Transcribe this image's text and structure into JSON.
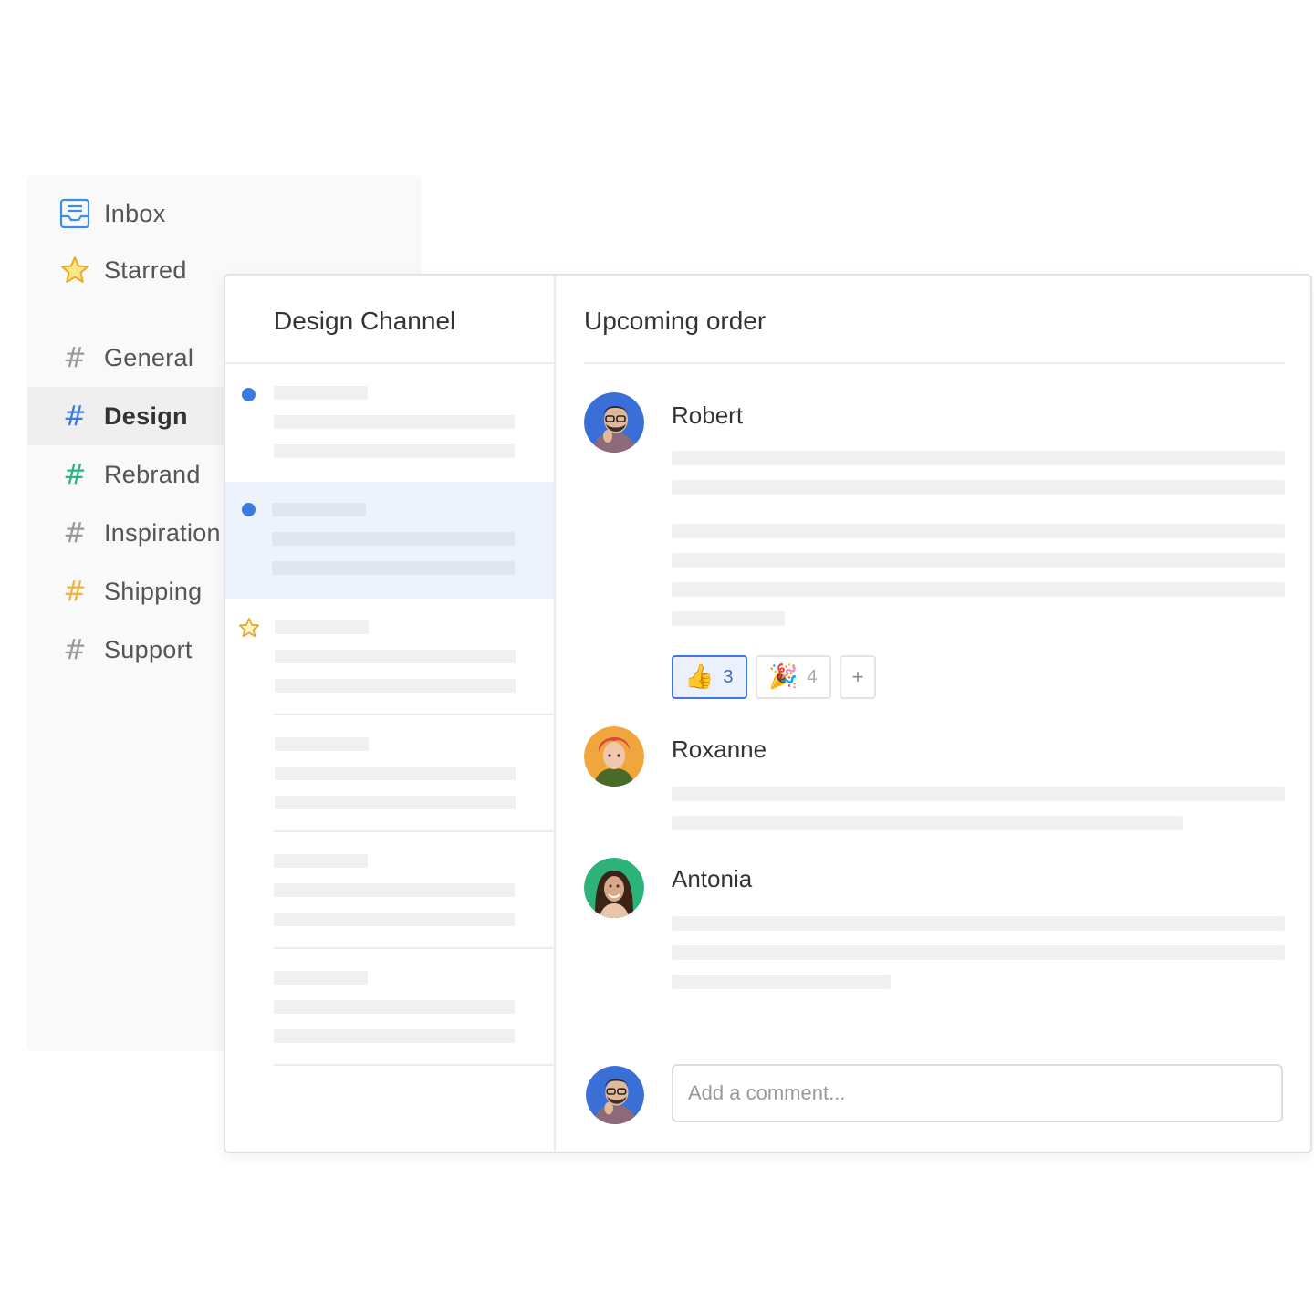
{
  "sidebar": {
    "inbox": {
      "label": "Inbox",
      "icon": "inbox-icon"
    },
    "starred": {
      "label": "Starred",
      "icon": "star-icon"
    },
    "channels": [
      {
        "label": "General",
        "color": "#8a8a8a",
        "active": false
      },
      {
        "label": "Design",
        "color": "#3b7be0",
        "active": true
      },
      {
        "label": "Rebrand",
        "color": "#2bb38a",
        "active": false
      },
      {
        "label": "Inspiration",
        "color": "#8a8a8a",
        "active": false
      },
      {
        "label": "Shipping",
        "color": "#f0b43a",
        "active": false
      },
      {
        "label": "Support",
        "color": "#8a8a8a",
        "active": false
      }
    ]
  },
  "channel_list": {
    "title": "Design Channel",
    "threads": [
      {
        "indicator": "unread-dot",
        "selected": false
      },
      {
        "indicator": "unread-dot",
        "selected": true
      },
      {
        "indicator": "star",
        "selected": false
      },
      {
        "indicator": "none",
        "selected": false
      },
      {
        "indicator": "none",
        "selected": false
      },
      {
        "indicator": "none",
        "selected": false
      }
    ]
  },
  "conversation": {
    "title": "Upcoming order",
    "messages": [
      {
        "author": "Robert",
        "avatar_color": "#3b6fd8"
      },
      {
        "author": "Roxanne",
        "avatar_color": "#f0a63a"
      },
      {
        "author": "Antonia",
        "avatar_color": "#2bb37a"
      }
    ],
    "reactions": [
      {
        "emoji": "👍",
        "count": "3",
        "active": true
      },
      {
        "emoji": "🎉",
        "count": "4",
        "active": false
      }
    ],
    "add_reaction_label": "+",
    "comment": {
      "placeholder": "Add a comment...",
      "value": ""
    }
  },
  "colors": {
    "accent": "#3b7be0",
    "selected_bg": "#edf3fd",
    "sidebar_bg": "#f9f9f9"
  }
}
